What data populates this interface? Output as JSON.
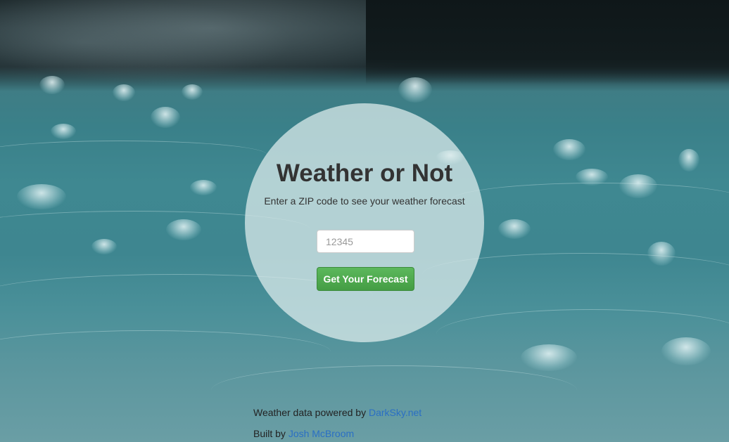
{
  "app": {
    "title": "Weather or Not",
    "subtitle": "Enter a ZIP code to see your weather forecast"
  },
  "form": {
    "zip_placeholder": "12345",
    "zip_value": "",
    "submit_label": "Get Your Forecast",
    "button_color": "#5cb85c"
  },
  "footer": {
    "powered_prefix": "Weather data powered by",
    "powered_link": "DarkSky.net",
    "built_prefix": "Built by",
    "built_link": "Josh McBroom",
    "link_color": "#2a6fc4"
  },
  "background": {
    "description_icon": "rain-on-water-photo"
  }
}
